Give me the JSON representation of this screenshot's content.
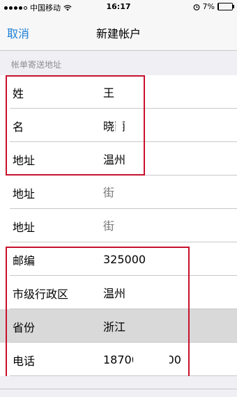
{
  "status_bar": {
    "carrier": "中国移动",
    "time": "16:17",
    "battery": "7%",
    "battery_level": 0.07
  },
  "nav": {
    "cancel_label": "取消",
    "title": "新建帐户"
  },
  "section": {
    "header": "帐单寄送地址"
  },
  "form": {
    "rows": [
      {
        "label": "姓",
        "value": "王",
        "placeholder": ""
      },
      {
        "label": "名",
        "value": "晓丽",
        "placeholder": ""
      },
      {
        "label": "地址",
        "value": "温州",
        "placeholder": ""
      },
      {
        "label": "地址",
        "value": "",
        "placeholder": "街"
      },
      {
        "label": "地址",
        "value": "",
        "placeholder": "街"
      },
      {
        "label": "邮编",
        "value": "325000",
        "placeholder": ""
      },
      {
        "label": "市级行政区",
        "value": "温州",
        "placeholder": ""
      },
      {
        "label": "省份",
        "value": "浙江",
        "placeholder": ""
      },
      {
        "label": "电话",
        "value": "18700000000",
        "placeholder": ""
      }
    ]
  },
  "colors": {
    "accent": "#1a7fd6",
    "annotation": "#c8102e",
    "highlight_row": "#d9d9d9",
    "background": "#efeff4"
  }
}
